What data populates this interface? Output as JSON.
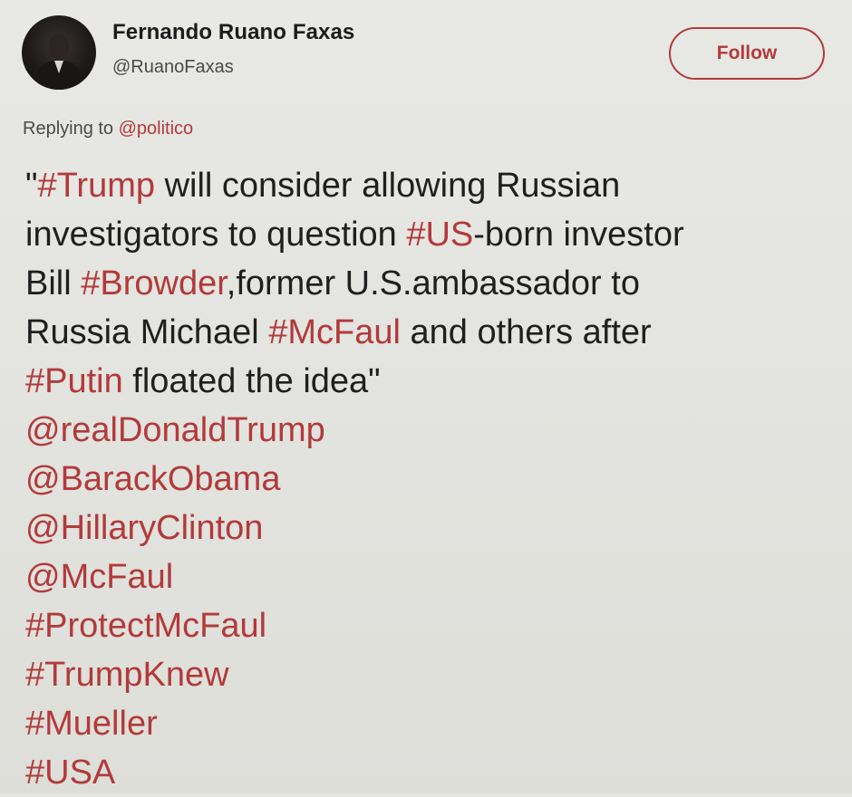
{
  "author": {
    "display_name": "Fernando Ruano Faxas",
    "handle": "@RuanoFaxas",
    "avatar_icon": "user-avatar"
  },
  "follow_button": {
    "label": "Follow"
  },
  "reply": {
    "prefix": "Replying to ",
    "handle": "@politico"
  },
  "colors": {
    "accent": "#b23a3a",
    "text": "#1f1f1f",
    "secondary_text": "#4a4a4a",
    "background": "#e4e4e0"
  },
  "tweet_lines": [
    [
      {
        "text": "\"",
        "type": "text"
      },
      {
        "text": "#Trump",
        "type": "hashtag"
      },
      {
        "text": " will consider allowing Russian",
        "type": "text"
      }
    ],
    [
      {
        "text": "investigators to question ",
        "type": "text"
      },
      {
        "text": "#US",
        "type": "hashtag"
      },
      {
        "text": "-born investor",
        "type": "text"
      }
    ],
    [
      {
        "text": "Bill ",
        "type": "text"
      },
      {
        "text": "#Browder",
        "type": "hashtag"
      },
      {
        "text": ",former U.S.ambassador to",
        "type": "text"
      }
    ],
    [
      {
        "text": "Russia Michael ",
        "type": "text"
      },
      {
        "text": "#McFaul",
        "type": "hashtag"
      },
      {
        "text": " and others after",
        "type": "text"
      }
    ],
    [
      {
        "text": "#Putin",
        "type": "hashtag"
      },
      {
        "text": " floated the idea\"",
        "type": "text"
      }
    ],
    [
      {
        "text": "@realDonaldTrump",
        "type": "mention"
      }
    ],
    [
      {
        "text": "@BarackObama",
        "type": "mention"
      }
    ],
    [
      {
        "text": "@HillaryClinton",
        "type": "mention"
      }
    ],
    [
      {
        "text": "@McFaul",
        "type": "mention"
      }
    ],
    [
      {
        "text": "#ProtectMcFaul",
        "type": "hashtag"
      }
    ],
    [
      {
        "text": "#TrumpKnew",
        "type": "hashtag"
      }
    ],
    [
      {
        "text": "#Mueller",
        "type": "hashtag"
      }
    ],
    [
      {
        "text": "#USA",
        "type": "hashtag"
      }
    ]
  ]
}
